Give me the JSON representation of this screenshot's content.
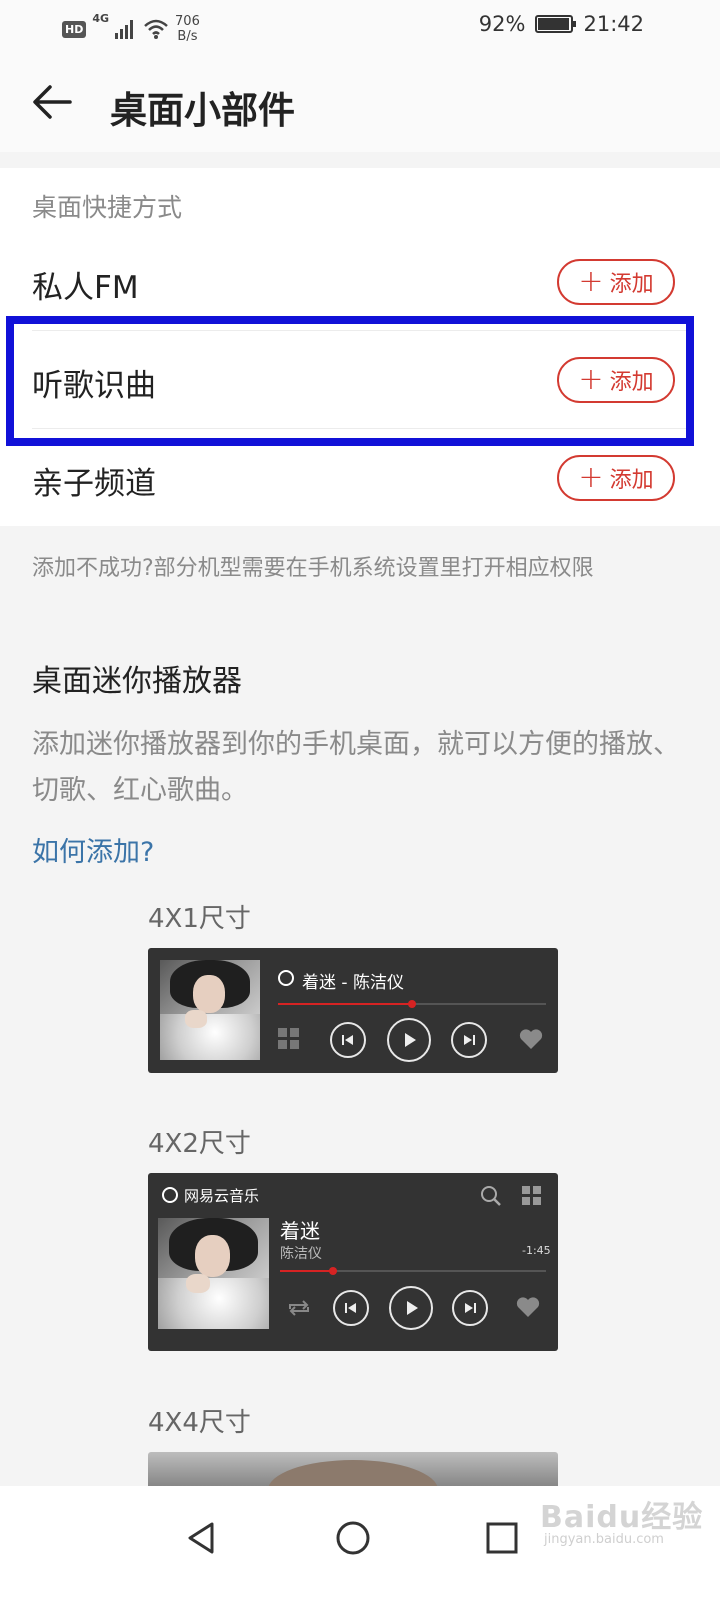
{
  "status_bar": {
    "hd": "HD",
    "network": "4G",
    "speed_value": "706",
    "speed_unit": "B/s",
    "battery_percent": "92%",
    "time": "21:42"
  },
  "header": {
    "title": "桌面小部件"
  },
  "shortcuts": {
    "section_label": "桌面快捷方式",
    "items": [
      {
        "label": "私人FM",
        "button_label": "添加"
      },
      {
        "label": "听歌识曲",
        "button_label": "添加"
      },
      {
        "label": "亲子频道",
        "button_label": "添加"
      }
    ],
    "tip": "添加不成功?部分机型需要在手机系统设置里打开相应权限"
  },
  "mini_player": {
    "title": "桌面迷你播放器",
    "description": "添加迷你播放器到你的手机桌面，就可以方便的播放、切歌、红心歌曲。",
    "how_to_link": "如何添加?",
    "sizes": [
      {
        "label": "4X1尺寸"
      },
      {
        "label": "4X2尺寸"
      },
      {
        "label": "4X4尺寸"
      }
    ],
    "widget_4x1": {
      "song_line": "着迷 - 陈洁仪",
      "progress": 0.5
    },
    "widget_4x2": {
      "brand": "网易云音乐",
      "song": "着迷",
      "artist": "陈洁仪",
      "remaining": "-1:45",
      "progress": 0.2
    }
  },
  "watermark": {
    "main": "Baidu经验",
    "sub": "jingyan.baidu.com"
  },
  "colors": {
    "accent_red": "#d33a31",
    "highlight_blue": "#1111d8",
    "link_blue": "#3b74a8"
  }
}
